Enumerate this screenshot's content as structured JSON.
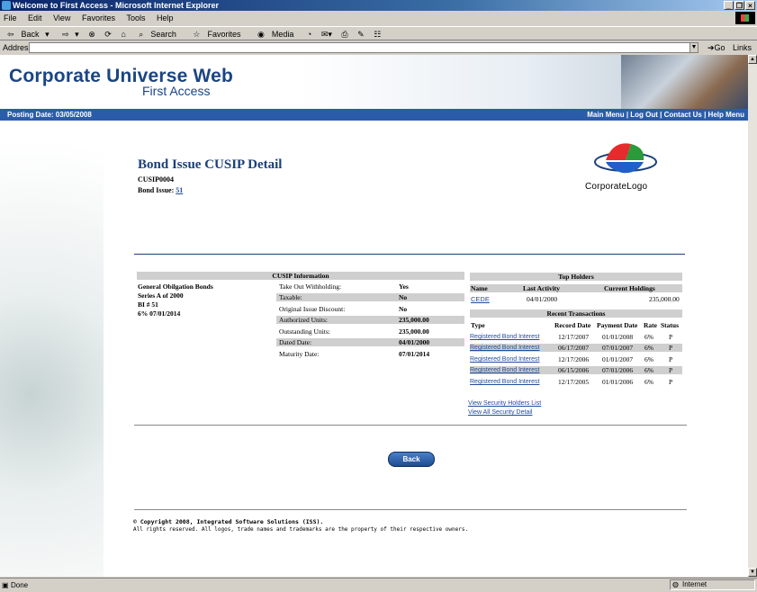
{
  "window": {
    "title": "Welcome to First Access - Microsoft Internet Explorer"
  },
  "menu": [
    "File",
    "Edit",
    "View",
    "Favorites",
    "Tools",
    "Help"
  ],
  "toolbar": {
    "back": "Back",
    "search": "Search",
    "favorites": "Favorites",
    "media": "Media"
  },
  "address": {
    "label": "Address",
    "go": "Go",
    "links": "Links"
  },
  "header": {
    "brand_main": "Corporate Universe Web",
    "brand_sub": "First Access"
  },
  "nav": {
    "posting_date": "Posting Date: 03/05/2008",
    "links": [
      "Main Menu",
      "Log Out",
      "Contact Us",
      "Help Menu"
    ]
  },
  "detail": {
    "title": "Bond Issue CUSIP Detail",
    "cusip": "CUSIP0004",
    "bond_issue_label": "Bond Issue:",
    "bond_issue_value": "51",
    "logo_text": "CorporateLogo"
  },
  "cusip_info": {
    "header": "CUSIP Information",
    "description": [
      "General Obilgation Bonds",
      "Series A of 2000",
      "BI # 51",
      "6% 07/01/2014"
    ],
    "fields": [
      {
        "label": "Take Out Withholding:",
        "value": "Yes"
      },
      {
        "label": "Taxable:",
        "value": "No"
      },
      {
        "label": "Original Issue Discount:",
        "value": "No"
      },
      {
        "label": "Authorized Units:",
        "value": "235,000.00"
      },
      {
        "label": "Outstanding Units:",
        "value": "235,000.00"
      },
      {
        "label": "Dated Date:",
        "value": "04/01/2000"
      },
      {
        "label": "Maturity Date:",
        "value": "07/01/2014"
      }
    ]
  },
  "top_holders": {
    "header": "Top Holders",
    "columns": [
      "Name",
      "Last Activity",
      "Current Holdings"
    ],
    "rows": [
      {
        "name": "CEDE",
        "last_activity": "04/01/2000",
        "holdings": "235,000.00"
      }
    ]
  },
  "recent_transactions": {
    "header": "Recent Transactions",
    "columns": [
      "Type",
      "Record Date",
      "Payment Date",
      "Rate",
      "Status"
    ],
    "rows": [
      {
        "type": "Registered Bond Interest",
        "record": "12/17/2007",
        "payment": "01/01/2008",
        "rate": "6%",
        "status": "P"
      },
      {
        "type": "Registered Bond Interest",
        "record": "06/17/2007",
        "payment": "07/01/2007",
        "rate": "6%",
        "status": "P"
      },
      {
        "type": "Registered Bond Interest",
        "record": "12/17/2006",
        "payment": "01/01/2007",
        "rate": "6%",
        "status": "P"
      },
      {
        "type": "Registered Bond Interest",
        "record": "06/15/2006",
        "payment": "07/01/2006",
        "rate": "6%",
        "status": "P"
      },
      {
        "type": "Registered Bond Interest",
        "record": "12/17/2005",
        "payment": "01/01/2006",
        "rate": "6%",
        "status": "P"
      }
    ]
  },
  "links": {
    "holders_list": "View Security Holders List",
    "all_detail": "View All Security Detail"
  },
  "back_button": "Back",
  "footer": {
    "copyright": "© Copyright 2008, Integrated Software Solutions (ISS).",
    "rights": "All rights reserved. All logos, trade names and trademarks are the property of their respective owners."
  },
  "status": {
    "left": "Done",
    "zone": "Internet"
  },
  "colors": {
    "brand": "#1b4583",
    "navbar": "#2a5caa",
    "table_header": "#cfcfcf",
    "link": "#1f4d9a"
  }
}
